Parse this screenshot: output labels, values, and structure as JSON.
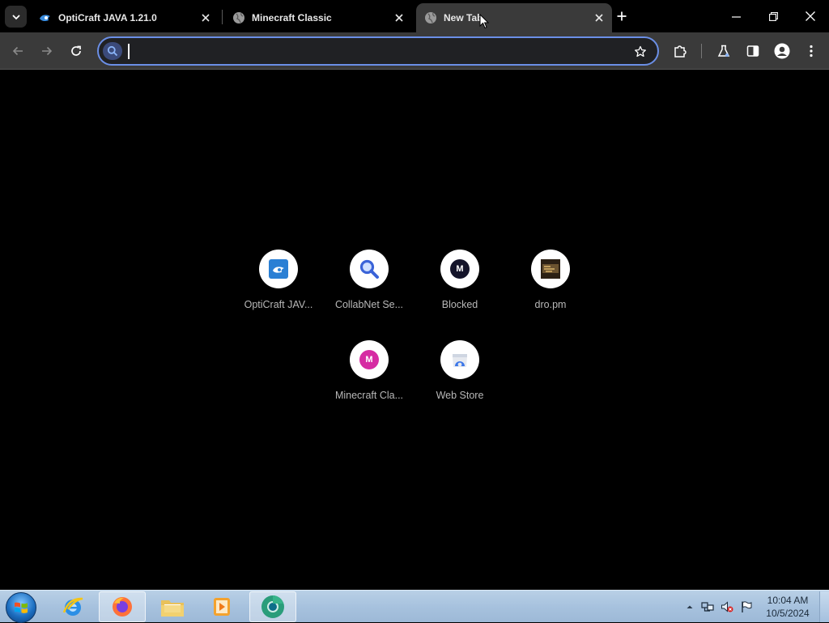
{
  "tabs": [
    {
      "title": "OptiCraft JAVA 1.21.0",
      "favicon": "opticraft-icon",
      "active": false
    },
    {
      "title": "Minecraft Classic",
      "favicon": "globe-icon",
      "active": false
    },
    {
      "title": "New Tab",
      "favicon": "globe-icon",
      "active": true
    }
  ],
  "omnibox": {
    "value": "",
    "placeholder": ""
  },
  "shortcuts": [
    {
      "label": "OptiCraft JAV...",
      "icon": "opticraft-icon"
    },
    {
      "label": "CollabNet Se...",
      "icon": "magnifier-icon"
    },
    {
      "label": "Blocked",
      "icon": "m-letter-icon",
      "letter": "M"
    },
    {
      "label": "dro.pm",
      "icon": "dro-pm-icon"
    },
    {
      "label": "Minecraft Cla...",
      "icon": "m-letter-icon",
      "letter": "M"
    },
    {
      "label": "Web Store",
      "icon": "web-store-icon"
    }
  ],
  "taskbar": {
    "apps": [
      "internet-explorer-icon",
      "firefox-icon",
      "file-explorer-icon",
      "media-player-icon",
      "chrome-icon"
    ],
    "clock": {
      "time": "10:04 AM",
      "date": "10/5/2024"
    }
  },
  "colors": {
    "accent": "#6b8fe6",
    "tab_active": "#3a3a3a",
    "toolbar": "#3a3a3a",
    "magenta": "#d62ba3",
    "blocked_dark": "#1a1a2e"
  }
}
